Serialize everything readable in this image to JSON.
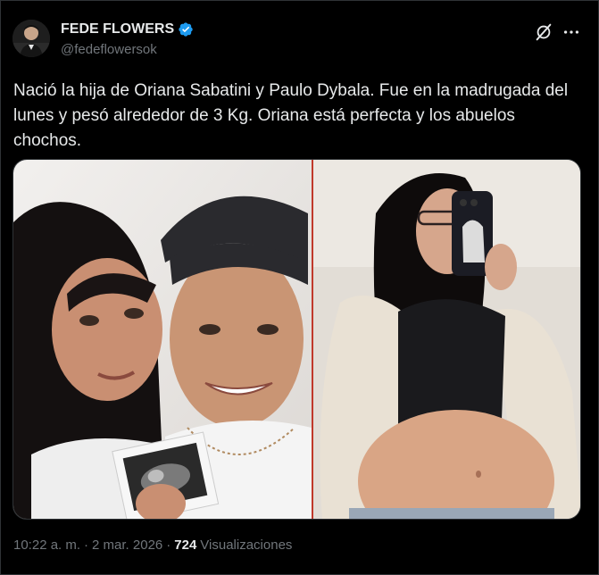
{
  "author": {
    "display_name": "FEDE FLOWERS",
    "handle": "@fedeflowersok",
    "verified": true,
    "avatar_icon": "user-avatar"
  },
  "icons": {
    "verified": "verified-badge-icon",
    "grok": "grok-icon",
    "more": "more-options-icon"
  },
  "tweet": {
    "text": "Nació la hija de Oriana Sabatini y Paulo Dybala. Fue en la madrugada del\nlunes y pesó alrededor de 3 Kg. Oriana está perfecta y los abuelos\nchochos."
  },
  "media": {
    "left_photo": "couple-with-ultrasound-photo",
    "right_photo": "pregnant-woman-mirror-selfie-photo"
  },
  "meta": {
    "time": "10:22 a. m.",
    "sep1": "·",
    "date": "2 mar. 2026",
    "sep2": "·",
    "views_count": "724",
    "views_label": "Visualizaciones"
  },
  "colors": {
    "background": "#000000",
    "text_primary": "#e7e9ea",
    "text_secondary": "#71767b",
    "verified_blue": "#1d9bf0",
    "border": "#2f3336"
  }
}
